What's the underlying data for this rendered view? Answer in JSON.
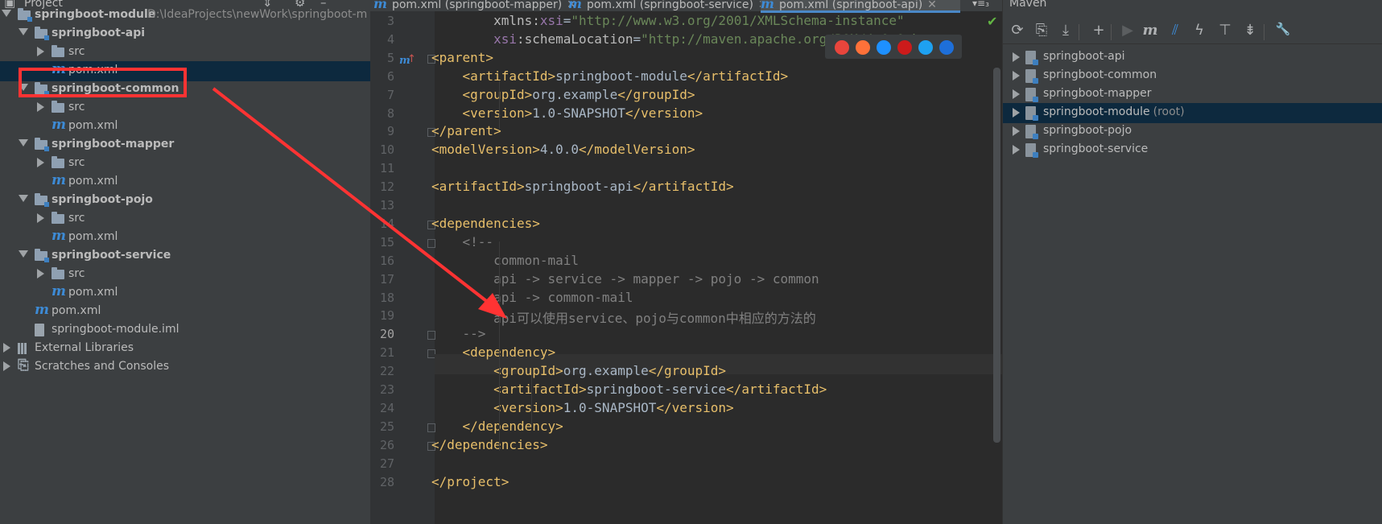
{
  "project_panel": {
    "title": "Project",
    "icons": [
      "settings-divider-icon",
      "gear-icon",
      "minimize-icon"
    ],
    "tree": [
      {
        "name": "tree-root",
        "label": "springboot-module",
        "path": "D:\\IdeaProjects\\newWork\\springboot-m",
        "kind": "module",
        "expanded": true
      },
      {
        "name": "tree-api",
        "label": "springboot-api",
        "kind": "module",
        "expanded": true
      },
      {
        "name": "tree-api-src",
        "label": "src",
        "kind": "folder",
        "expanded": false
      },
      {
        "name": "tree-api-pom",
        "label": "pom.xml",
        "kind": "maven",
        "selected": true
      },
      {
        "name": "tree-common",
        "label": "springboot-common",
        "kind": "module",
        "expanded": true
      },
      {
        "name": "tree-common-src",
        "label": "src",
        "kind": "folder",
        "expanded": false
      },
      {
        "name": "tree-common-pom",
        "label": "pom.xml",
        "kind": "maven"
      },
      {
        "name": "tree-mapper",
        "label": "springboot-mapper",
        "kind": "module",
        "expanded": true
      },
      {
        "name": "tree-mapper-src",
        "label": "src",
        "kind": "folder",
        "expanded": false
      },
      {
        "name": "tree-mapper-pom",
        "label": "pom.xml",
        "kind": "maven"
      },
      {
        "name": "tree-pojo",
        "label": "springboot-pojo",
        "kind": "module",
        "expanded": true
      },
      {
        "name": "tree-pojo-src",
        "label": "src",
        "kind": "folder",
        "expanded": false
      },
      {
        "name": "tree-pojo-pom",
        "label": "pom.xml",
        "kind": "maven"
      },
      {
        "name": "tree-service",
        "label": "springboot-service",
        "kind": "module",
        "expanded": true
      },
      {
        "name": "tree-service-src",
        "label": "src",
        "kind": "folder",
        "expanded": false
      },
      {
        "name": "tree-service-pom",
        "label": "pom.xml",
        "kind": "maven"
      },
      {
        "name": "tree-root-pom",
        "label": "pom.xml",
        "kind": "maven"
      },
      {
        "name": "tree-root-iml",
        "label": "springboot-module.iml",
        "kind": "iml"
      },
      {
        "name": "tree-external-libraries",
        "label": "External Libraries",
        "kind": "libraries",
        "expanded": false
      },
      {
        "name": "tree-scratches",
        "label": "Scratches and Consoles",
        "kind": "scratches",
        "expanded": false
      }
    ]
  },
  "editor": {
    "tabs": [
      {
        "label": "pom.xml (springboot-mapper)"
      },
      {
        "label": "pom.xml (springboot-service)"
      },
      {
        "label": "pom.xml (springboot-api)",
        "active": true
      }
    ],
    "tab_overflow": "▾≡₃",
    "lines": [
      {
        "n": "3",
        "code": [
          [
            "",
            "        "
          ],
          [
            "attr",
            "xmlns:"
          ],
          [
            "ns",
            "xsi"
          ],
          [
            "",
            "="
          ],
          [
            "str",
            "\"http://www.w3.org/2001/XMLSchema-instance\""
          ]
        ]
      },
      {
        "n": "4",
        "code": [
          [
            "",
            "        "
          ],
          [
            "ns",
            "xsi"
          ],
          [
            "attr",
            ":schemaLocation"
          ],
          [
            "",
            "="
          ],
          [
            "str",
            "\"http://maven.apache.org/POM/4.0.0 h"
          ]
        ]
      },
      {
        "n": "5",
        "code": [
          [
            "tag",
            "<parent>"
          ]
        ]
      },
      {
        "n": "6",
        "code": [
          [
            "",
            "    "
          ],
          [
            "tag",
            "<artifactId>"
          ],
          [
            "",
            "springboot-module"
          ],
          [
            "tag",
            "</artifactId>"
          ]
        ]
      },
      {
        "n": "7",
        "code": [
          [
            "",
            "    "
          ],
          [
            "tag",
            "<groupId>"
          ],
          [
            "",
            "org.example"
          ],
          [
            "tag",
            "</groupId>"
          ]
        ]
      },
      {
        "n": "8",
        "code": [
          [
            "",
            "    "
          ],
          [
            "tag",
            "<version>"
          ],
          [
            "",
            "1.0-SNAPSHOT"
          ],
          [
            "tag",
            "</version>"
          ]
        ]
      },
      {
        "n": "9",
        "code": [
          [
            "tag",
            "</parent>"
          ]
        ]
      },
      {
        "n": "10",
        "code": [
          [
            "tag",
            "<modelVersion>"
          ],
          [
            "",
            "4.0.0"
          ],
          [
            "tag",
            "</modelVersion>"
          ]
        ]
      },
      {
        "n": "11",
        "code": [
          [
            "",
            ""
          ]
        ]
      },
      {
        "n": "12",
        "code": [
          [
            "tag",
            "<artifactId>"
          ],
          [
            "",
            "springboot-api"
          ],
          [
            "tag",
            "</artifactId>"
          ]
        ]
      },
      {
        "n": "13",
        "code": [
          [
            "",
            ""
          ]
        ]
      },
      {
        "n": "14",
        "code": [
          [
            "tag",
            "<dependencies>"
          ]
        ]
      },
      {
        "n": "15",
        "code": [
          [
            "",
            "    "
          ],
          [
            "cmt",
            "<!--"
          ]
        ]
      },
      {
        "n": "16",
        "code": [
          [
            "",
            "        "
          ],
          [
            "cmt",
            "common-mail"
          ]
        ]
      },
      {
        "n": "17",
        "code": [
          [
            "",
            "        "
          ],
          [
            "cmt",
            "api -> service -> mapper -> pojo -> common"
          ]
        ]
      },
      {
        "n": "18",
        "code": [
          [
            "",
            "        "
          ],
          [
            "cmt",
            "api -> common-mail"
          ]
        ]
      },
      {
        "n": "19",
        "code": [
          [
            "",
            "        "
          ],
          [
            "cmt",
            "api可以使用service、pojo与common中相应的方法的"
          ]
        ]
      },
      {
        "n": "20",
        "code": [
          [
            "",
            "    "
          ],
          [
            "cmt",
            "-->"
          ]
        ]
      },
      {
        "n": "21",
        "code": [
          [
            "",
            "    "
          ],
          [
            "tag",
            "<dependency>"
          ]
        ]
      },
      {
        "n": "22",
        "code": [
          [
            "",
            "        "
          ],
          [
            "tag",
            "<groupId>"
          ],
          [
            "",
            "org.example"
          ],
          [
            "tag",
            "</groupId>"
          ]
        ]
      },
      {
        "n": "23",
        "code": [
          [
            "",
            "        "
          ],
          [
            "tag",
            "<artifactId>"
          ],
          [
            "",
            "springboot-service"
          ],
          [
            "tag",
            "</artifactId>"
          ]
        ]
      },
      {
        "n": "24",
        "code": [
          [
            "",
            "        "
          ],
          [
            "tag",
            "<version>"
          ],
          [
            "",
            "1.0-SNAPSHOT"
          ],
          [
            "tag",
            "</version>"
          ]
        ]
      },
      {
        "n": "25",
        "code": [
          [
            "",
            "    "
          ],
          [
            "tag",
            "</dependency>"
          ]
        ]
      },
      {
        "n": "26",
        "code": [
          [
            "tag",
            "</dependencies>"
          ]
        ]
      },
      {
        "n": "27",
        "code": [
          [
            "",
            ""
          ]
        ]
      },
      {
        "n": "28",
        "code": [
          [
            "tag",
            "</project>"
          ]
        ]
      }
    ],
    "current_line": "20",
    "browser_icons": [
      "chrome-icon",
      "firefox-icon",
      "safari-icon",
      "opera-icon",
      "ie-icon",
      "edge-icon"
    ],
    "browser_colors": [
      "#e8453c",
      "#ff7139",
      "#1e90ff",
      "#cc1b1b",
      "#1ea1f1",
      "#1e6fd9"
    ]
  },
  "maven_panel": {
    "title": "Maven",
    "toolbar": [
      "refresh-icon",
      "generate-sources-icon",
      "download-icon",
      "add-icon",
      "run-icon",
      "execute-goal-icon",
      "toggle-offline-icon",
      "skip-tests-icon",
      "show-dependencies-icon",
      "collapse-all-icon",
      "settings-icon"
    ],
    "projects": [
      {
        "label": "springboot-api"
      },
      {
        "label": "springboot-common"
      },
      {
        "label": "springboot-mapper"
      },
      {
        "label": "springboot-module",
        "suffix": "(root)",
        "selected": true
      },
      {
        "label": "springboot-pojo"
      },
      {
        "label": "springboot-service"
      }
    ]
  },
  "colors": {
    "accent": "#4a88c7",
    "selection": "#0d293e",
    "annotation": "#ff3333"
  }
}
